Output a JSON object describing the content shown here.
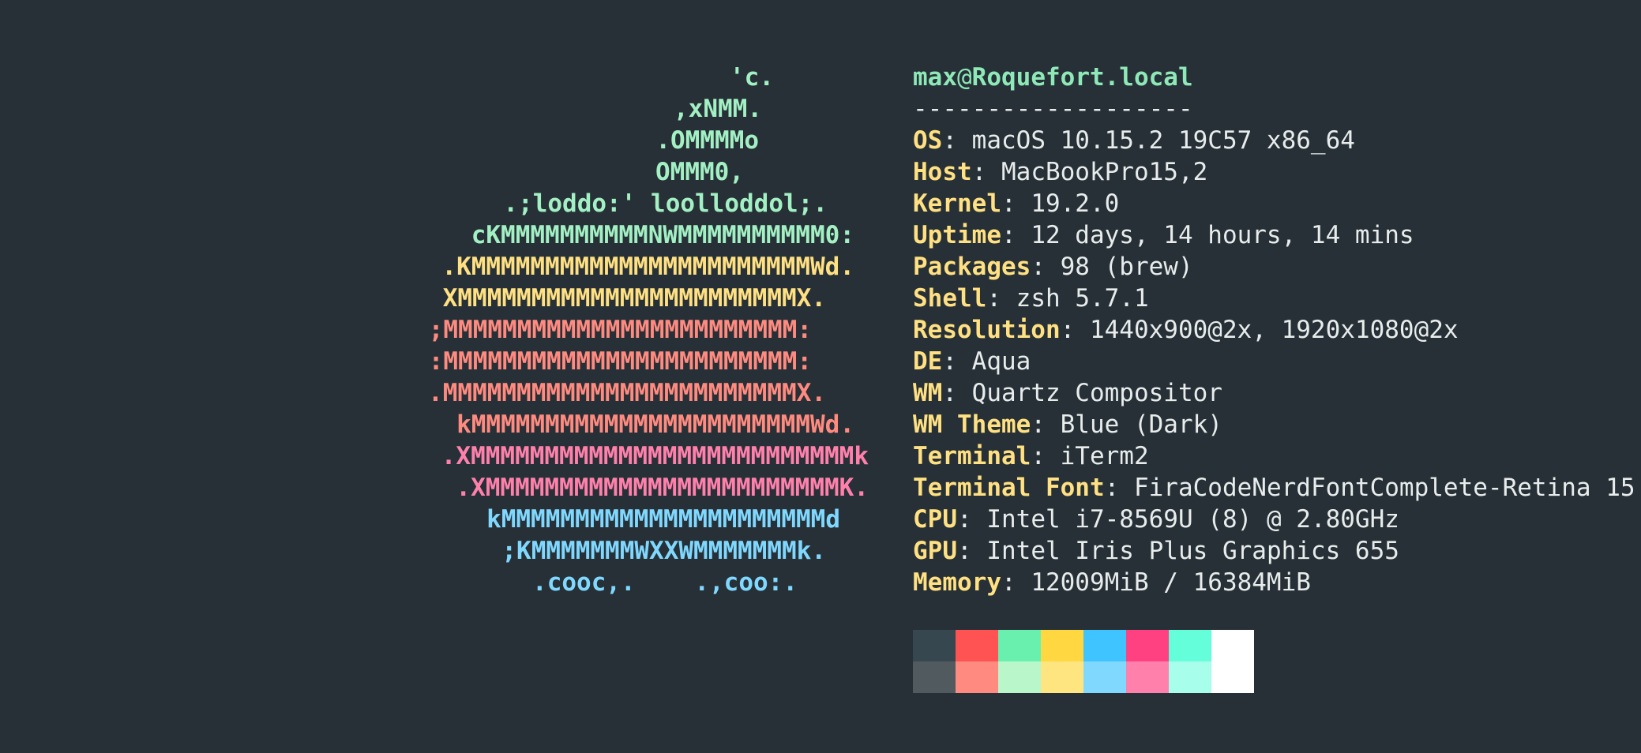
{
  "colors": {
    "background": "#263036",
    "logo_green": "#a3f0c4",
    "logo_yellow": "#ffe082",
    "logo_red": "#ff8a80",
    "logo_pink": "#ff80ab",
    "logo_blue": "#80d8ff",
    "label": "#ffe082",
    "value": "#e8ecec",
    "title": "#8ee8b8"
  },
  "logo": [
    {
      "text": "'c.",
      "color": "#a3f0c4"
    },
    {
      "text": ",xNMM.",
      "color": "#a3f0c4"
    },
    {
      "text": ".OMMMMo",
      "color": "#a3f0c4"
    },
    {
      "text": "OMMM0,",
      "color": "#a3f0c4"
    },
    {
      "text": ".;loddo:' loolloddol;.",
      "color": "#a3f0c4"
    },
    {
      "text": "cKMMMMMMMMMMNWMMMMMMMMMM0:",
      "color": "#a3f0c4"
    },
    {
      "text": ".KMMMMMMMMMMMMMMMMMMMMMMMWd.",
      "color": "#ffe082"
    },
    {
      "text": "XMMMMMMMMMMMMMMMMMMMMMMMX.",
      "color": "#ffe082"
    },
    {
      "text": ";MMMMMMMMMMMMMMMMMMMMMMMM:",
      "color": "#ff8a80"
    },
    {
      "text": ":MMMMMMMMMMMMMMMMMMMMMMMM:",
      "color": "#ff8a80"
    },
    {
      "text": ".MMMMMMMMMMMMMMMMMMMMMMMMX.",
      "color": "#ff8a80"
    },
    {
      "text": "kMMMMMMMMMMMMMMMMMMMMMMMWd.",
      "color": "#ff8a80"
    },
    {
      "text": ".XMMMMMMMMMMMMMMMMMMMMMMMMMMk",
      "color": "#ff80ab"
    },
    {
      "text": ".XMMMMMMMMMMMMMMMMMMMMMMMMK.",
      "color": "#ff80ab"
    },
    {
      "text": "kMMMMMMMMMMMMMMMMMMMMMMd",
      "color": "#80d8ff"
    },
    {
      "text": ";KMMMMMMMWXXWMMMMMMMk.",
      "color": "#80d8ff"
    },
    {
      "text": ".cooc,.    .,coo:.",
      "color": "#80d8ff"
    }
  ],
  "title": {
    "user": "max",
    "at": "@",
    "host": "Roquefort.local",
    "underline": "-------------------"
  },
  "info": [
    {
      "label": "OS",
      "value": " macOS 10.15.2 19C57 x86_64"
    },
    {
      "label": "Host",
      "value": " MacBookPro15,2"
    },
    {
      "label": "Kernel",
      "value": " 19.2.0"
    },
    {
      "label": "Uptime",
      "value": " 12 days, 14 hours, 14 mins"
    },
    {
      "label": "Packages",
      "value": " 98 (brew)"
    },
    {
      "label": "Shell",
      "value": " zsh 5.7.1"
    },
    {
      "label": "Resolution",
      "value": " 1440x900@2x, 1920x1080@2x"
    },
    {
      "label": "DE",
      "value": " Aqua"
    },
    {
      "label": "WM",
      "value": " Quartz Compositor"
    },
    {
      "label": "WM Theme",
      "value": " Blue (Dark)"
    },
    {
      "label": "Terminal",
      "value": " iTerm2"
    },
    {
      "label": "Terminal Font",
      "value": " FiraCodeNerdFontComplete-Retina 15"
    },
    {
      "label": "CPU",
      "value": " Intel i7-8569U (8) @ 2.80GHz"
    },
    {
      "label": "GPU",
      "value": " Intel Iris Plus Graphics 655"
    },
    {
      "label": "Memory",
      "value": " 12009MiB / 16384MiB"
    }
  ],
  "palette": {
    "normal": [
      "#37474f",
      "#ff5252",
      "#69f0ae",
      "#ffd740",
      "#40c4ff",
      "#ff4081",
      "#64ffda",
      "#ffffff"
    ],
    "bright": [
      "#515a5e",
      "#ff8a80",
      "#b9f6ca",
      "#ffe57f",
      "#80d8ff",
      "#ff80ab",
      "#a7ffeb",
      "#ffffff"
    ]
  }
}
